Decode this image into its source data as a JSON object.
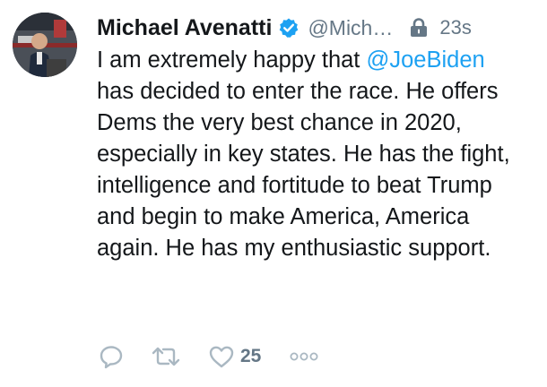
{
  "tweet": {
    "author": {
      "display_name": "Michael Avenatti",
      "handle": "@Mich…",
      "verified": true,
      "avatar_icon": "profile-photo"
    },
    "protected_icon": "lock-icon",
    "timestamp": "23s",
    "text": {
      "before_mention": "I am extremely happy that ",
      "mention": "@JoeBiden",
      "after_mention": " has decided to enter the race. He offers Dems the very best chance in 2020, especially in key states. He has the fight, intelligence and fortitude to beat Trump and begin to make America, America again. He has my enthusiastic support."
    },
    "actions": {
      "reply_icon": "reply-icon",
      "retweet_icon": "retweet-icon",
      "like_icon": "heart-icon",
      "like_count": "25",
      "more_icon": "more-icon"
    }
  },
  "colors": {
    "text": "#14171a",
    "secondary": "#657786",
    "link": "#1da1f2",
    "verified_badge": "#1da1f2",
    "icon_gray": "#aab8c2"
  }
}
